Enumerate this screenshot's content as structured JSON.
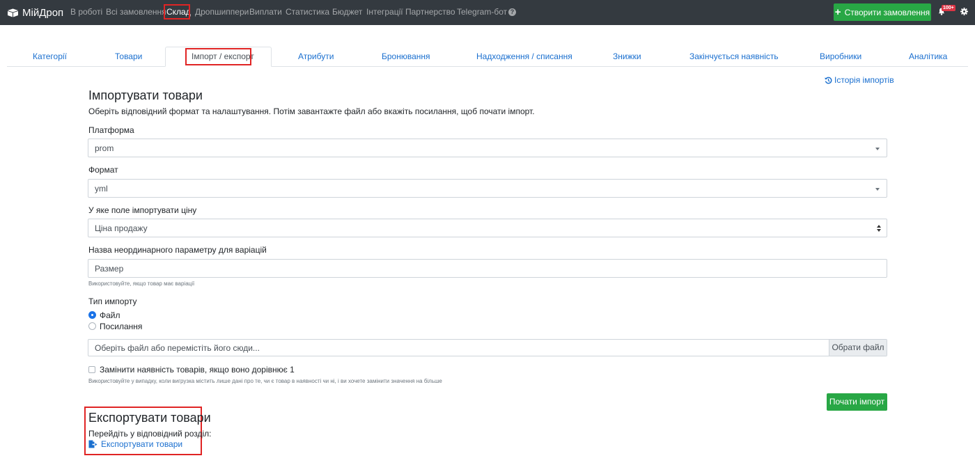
{
  "navbar": {
    "brand": "МійДроп",
    "items": [
      {
        "label": "В роботі",
        "active": false
      },
      {
        "label": "Всі замовлення",
        "active": false
      },
      {
        "label": "Склад",
        "active": true
      },
      {
        "label": "Дропшиппери",
        "active": false
      },
      {
        "label": "Виплати",
        "active": false
      },
      {
        "label": "Статистика",
        "active": false
      },
      {
        "label": "Бюджет",
        "active": false
      },
      {
        "label": "Інтеграції",
        "active": false
      },
      {
        "label": "Партнерство",
        "active": false
      },
      {
        "label": "Telegram-бот",
        "active": false
      }
    ],
    "create_order": "Створити замовлення",
    "notifications_badge": "100+"
  },
  "tabs": [
    {
      "label": "Категорії",
      "active": false
    },
    {
      "label": "Товари",
      "active": false
    },
    {
      "label": "Імпорт / експорт",
      "active": true
    },
    {
      "label": "Атрибути",
      "active": false
    },
    {
      "label": "Бронювання",
      "active": false
    },
    {
      "label": "Надходження / списання",
      "active": false
    },
    {
      "label": "Знижки",
      "active": false
    },
    {
      "label": "Закінчується наявність",
      "active": false
    },
    {
      "label": "Виробники",
      "active": false
    },
    {
      "label": "Аналітика",
      "active": false
    }
  ],
  "history_link": "Історія імпортів",
  "import": {
    "title": "Імпортувати товари",
    "description": "Оберіть відповідний формат та налаштування. Потім завантажте файл або вкажіть посилання, щоб почати імпорт.",
    "platform_label": "Платформа",
    "platform_value": "prom",
    "format_label": "Формат",
    "format_value": "yml",
    "price_field_label": "У яке поле імпортувати ціну",
    "price_field_value": "Ціна продажу",
    "variation_param_label": "Назва неординарного параметру для варіацій",
    "variation_param_value": "Размер",
    "variation_param_help": "Використовуйте, якщо товар має варіації",
    "import_type_label": "Тип импорту",
    "import_type_options": [
      {
        "label": "Файл",
        "checked": true
      },
      {
        "label": "Посилання",
        "checked": false
      }
    ],
    "file_placeholder": "Оберіть файл або перемістіть його сюди...",
    "file_button": "Обрати файл",
    "replace_stock_label": "Замінити наявність товарів, якщо воно дорівнює 1",
    "replace_stock_checked": false,
    "replace_stock_help": "Використовуйте у випадку, коли вигрузка містить лише дані про те, чи є товар в наявності чи ні, і ви хочете замінити значення на більше",
    "start_button": "Почати імпорт"
  },
  "export": {
    "title": "Експортувати товари",
    "description": "Перейдіть у відповідний розділ:",
    "link": "Експортувати товари"
  },
  "colors": {
    "navbar_bg": "#343a40",
    "accent_green": "#28a745",
    "link_blue": "#1a6fcf",
    "highlight_red": "#e02424",
    "radio_blue": "#1a73e8"
  }
}
